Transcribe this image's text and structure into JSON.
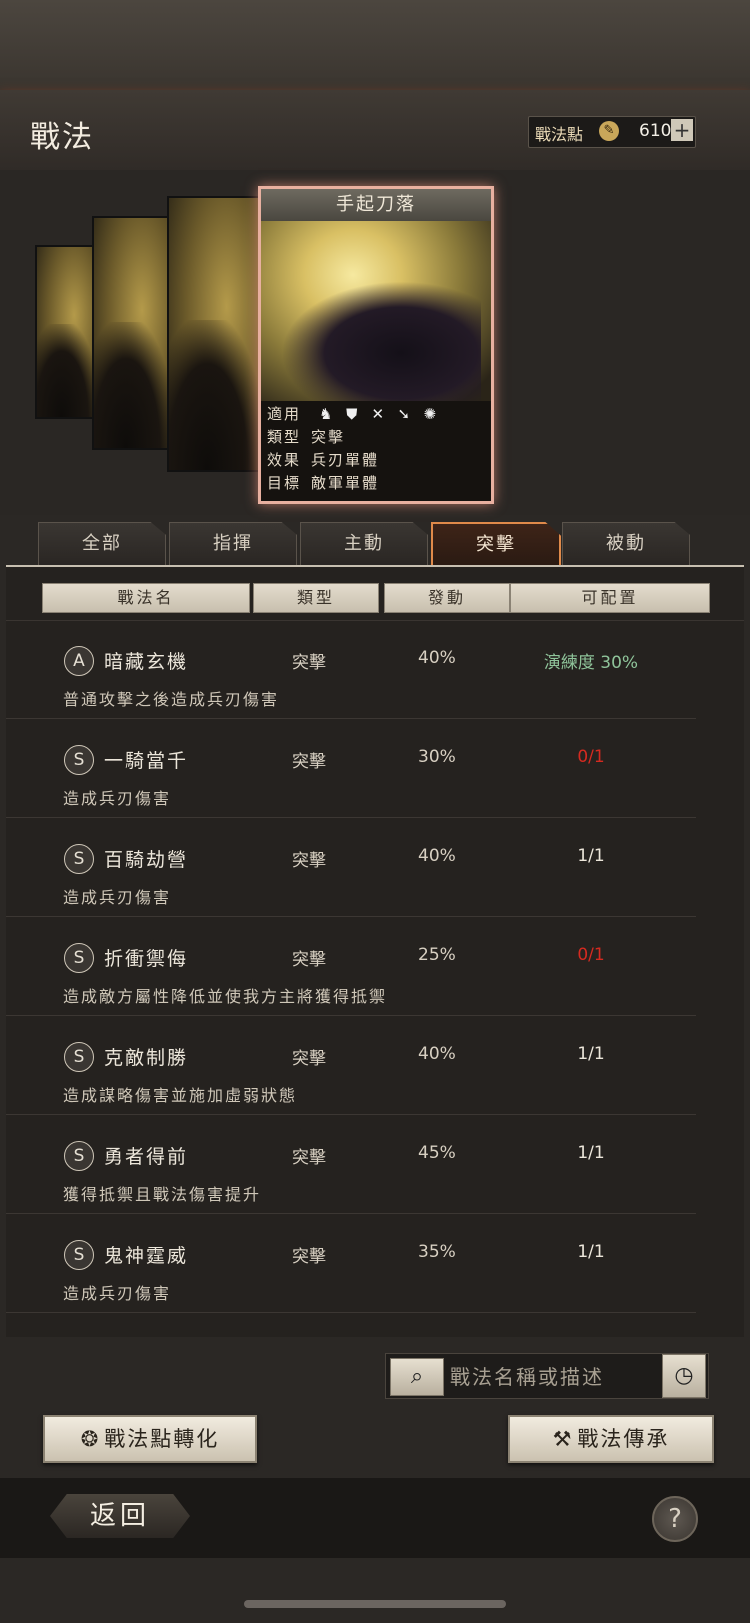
{
  "header": {
    "title": "戰法",
    "points_label": "戰法點",
    "points_value": "610",
    "plus_label": "+"
  },
  "card": {
    "name": "手起刀落",
    "rows": [
      {
        "key": "適用",
        "value": ""
      },
      {
        "key": "類型",
        "value": "突擊"
      },
      {
        "key": "效果",
        "value": "兵刃單體"
      },
      {
        "key": "目標",
        "value": "敵軍單體"
      }
    ],
    "troop_icons": [
      "cavalry-icon",
      "shield-icon",
      "archer-icon",
      "spear-icon",
      "wheel-icon"
    ]
  },
  "tabs": [
    {
      "label": "全部"
    },
    {
      "label": "指揮"
    },
    {
      "label": "主動"
    },
    {
      "label": "突擊",
      "active": true
    },
    {
      "label": "被動"
    }
  ],
  "columns": [
    "戰法名",
    "類型",
    "發動",
    "可配置"
  ],
  "tactics": [
    {
      "grade": "A",
      "name": "暗藏玄機",
      "type": "突擊",
      "rate": "40%",
      "slot": "演練度 30%",
      "slot_color": "#8fc49a",
      "desc": "普通攻擊之後造成兵刃傷害"
    },
    {
      "grade": "S",
      "name": "一騎當千",
      "type": "突擊",
      "rate": "30%",
      "slot": "0/1",
      "slot_color": "#d42a20",
      "desc": "造成兵刃傷害"
    },
    {
      "grade": "S",
      "name": "百騎劫營",
      "type": "突擊",
      "rate": "40%",
      "slot": "1/1",
      "slot_color": "#ece6da",
      "desc": "造成兵刃傷害"
    },
    {
      "grade": "S",
      "name": "折衝禦侮",
      "type": "突擊",
      "rate": "25%",
      "slot": "0/1",
      "slot_color": "#d42a20",
      "desc": "造成敵方屬性降低並使我方主將獲得抵禦"
    },
    {
      "grade": "S",
      "name": "克敵制勝",
      "type": "突擊",
      "rate": "40%",
      "slot": "1/1",
      "slot_color": "#ece6da",
      "desc": "造成謀略傷害並施加虛弱狀態"
    },
    {
      "grade": "S",
      "name": "勇者得前",
      "type": "突擊",
      "rate": "45%",
      "slot": "1/1",
      "slot_color": "#ece6da",
      "desc": "獲得抵禦且戰法傷害提升"
    },
    {
      "grade": "S",
      "name": "鬼神霆威",
      "type": "突擊",
      "rate": "35%",
      "slot": "1/1",
      "slot_color": "#ece6da",
      "desc": "造成兵刃傷害"
    }
  ],
  "search": {
    "placeholder": "戰法名稱或描述"
  },
  "buttons": {
    "convert": "戰法點轉化",
    "inherit": "戰法傳承",
    "back": "返回",
    "help": "?"
  }
}
